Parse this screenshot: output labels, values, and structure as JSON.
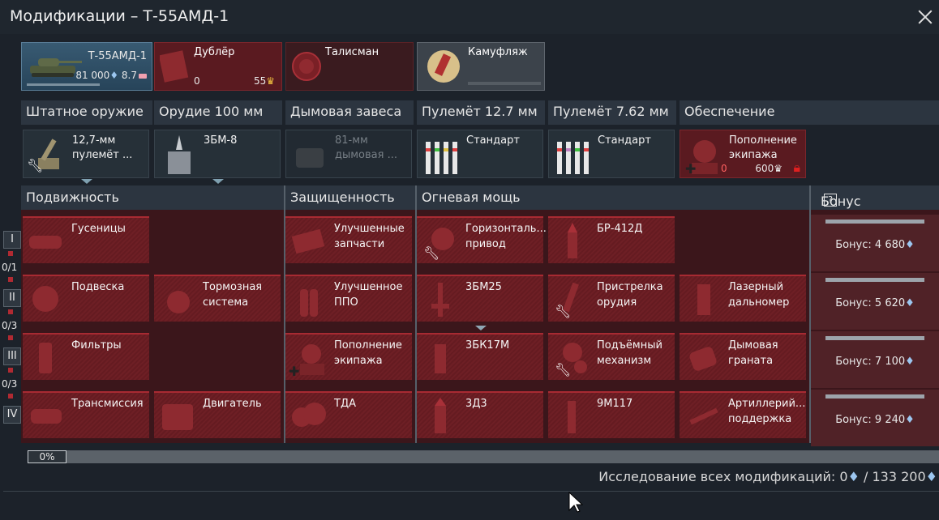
{
  "window": {
    "title": "Модификации – Т-55АМД-1"
  },
  "vehicle": {
    "name": "Т-55АМД-1",
    "value": "81 000",
    "br": "8.7"
  },
  "crew": {
    "label": "Дублёр",
    "count": "0",
    "cost": "55"
  },
  "mascot": {
    "label": "Талисман"
  },
  "camo": {
    "label": "Камуфляж"
  },
  "weapon_headers": [
    "Штатное оружие",
    "Орудие 100 мм",
    "Дымовая завеса",
    "Пулемёт 12.7 мм",
    "Пулемёт 7.62 мм",
    "Обеспечение"
  ],
  "weapons": [
    {
      "label1": "12,7-мм",
      "label2": "пулемёт ..."
    },
    {
      "label1": "3БМ-8",
      "label2": ""
    },
    {
      "label1": "81-мм",
      "label2": "дымовая ..."
    },
    {
      "label1": "Стандарт",
      "label2": ""
    },
    {
      "label1": "Стандарт",
      "label2": ""
    },
    {
      "label1": "Пополнение",
      "label2": "экипажа",
      "count": "0",
      "cost": "600"
    }
  ],
  "sections": {
    "mobility": "Подвижность",
    "protection": "Защищенность",
    "firepower": "Огневая мощь",
    "bonus": "Бонус ступени",
    "help": "?"
  },
  "tiers": [
    {
      "name": "I",
      "progress": "0/1"
    },
    {
      "name": "II",
      "progress": "0/3"
    },
    {
      "name": "III",
      "progress": "0/3"
    },
    {
      "name": "IV",
      "progress": ""
    }
  ],
  "mods": {
    "tracks": {
      "l1": "Гусеницы",
      "l2": ""
    },
    "suspension": {
      "l1": "Подвеска",
      "l2": ""
    },
    "brakes": {
      "l1": "Тормозная",
      "l2": "система"
    },
    "filters": {
      "l1": "Фильтры",
      "l2": ""
    },
    "transmission": {
      "l1": "Трансмиссия",
      "l2": ""
    },
    "engine": {
      "l1": "Двигатель",
      "l2": ""
    },
    "parts": {
      "l1": "Улучшенные",
      "l2": "запчасти"
    },
    "fire_prot": {
      "l1": "Улучшенное",
      "l2": "ППО"
    },
    "crew_rep": {
      "l1": "Пополнение",
      "l2": "экипажа"
    },
    "tda": {
      "l1": "ТДА",
      "l2": ""
    },
    "horiz": {
      "l1": "Горизонталь...",
      "l2": "привод"
    },
    "br412": {
      "l1": "БР-412Д",
      "l2": ""
    },
    "bm25": {
      "l1": "3БМ25",
      "l2": ""
    },
    "adjust": {
      "l1": "Пристрелка",
      "l2": "орудия"
    },
    "laser": {
      "l1": "Лазерный",
      "l2": "дальномер"
    },
    "bk17": {
      "l1": "3БК17М",
      "l2": ""
    },
    "elev": {
      "l1": "Подъёмный",
      "l2": "механизм"
    },
    "smoke": {
      "l1": "Дымовая",
      "l2": "граната"
    },
    "d3": {
      "l1": "3Д3",
      "l2": ""
    },
    "m117": {
      "l1": "9М117",
      "l2": ""
    },
    "art": {
      "l1": "Артиллерий...",
      "l2": "поддержка"
    }
  },
  "bonuses": [
    "Бонус: 4 680",
    "Бонус: 5 620",
    "Бонус: 7 100",
    "Бонус: 9 240"
  ],
  "progress": {
    "percent": "0%",
    "fill": 0.0
  },
  "total": {
    "label": "Исследование всех модификаций: 0",
    "separator": " / ",
    "max": "133 200"
  },
  "colors": {
    "accent_red": "#a82a32",
    "gem": "#9cc6ef"
  }
}
